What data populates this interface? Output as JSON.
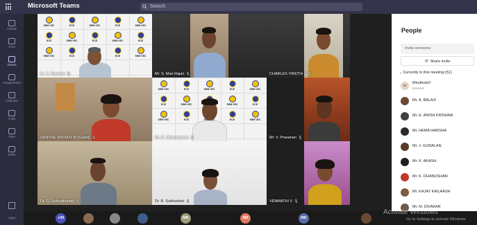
{
  "app": {
    "title": "Microsoft Teams"
  },
  "search": {
    "label": "Search"
  },
  "rail": {
    "items": [
      {
        "label": "Activity",
        "icon": "bell-icon"
      },
      {
        "label": "Chat",
        "icon": "chat-icon"
      },
      {
        "label": "Teams",
        "icon": "teams-icon"
      },
      {
        "label": "Assignments",
        "icon": "assignments-icon"
      },
      {
        "label": "Calendar",
        "icon": "calendar-icon"
      },
      {
        "label": "Calls",
        "icon": "phone-icon"
      },
      {
        "label": "Files",
        "icon": "file-icon"
      },
      {
        "label": "Shifts",
        "icon": "shifts-icon"
      }
    ],
    "apps_label": "Apps"
  },
  "logo_wall": {
    "college_short": "SRM VEC",
    "dept": "ECE"
  },
  "participants_video": [
    {
      "name": "Dr. S. Ramesh"
    },
    {
      "name": "Mr. S. Mari Rajan"
    },
    {
      "name": "CHARLES VINOTH J"
    },
    {
      "name": "SENTHIL PRIYA R M (Guest)"
    },
    {
      "name": "Mr. R. Dhananjeyan"
    },
    {
      "name": "Mr. V. Prasanan"
    },
    {
      "name": "Dr. G. Sathyakumar"
    },
    {
      "name": "Dr. B. Subhashini"
    },
    {
      "name": "VENMATHI V"
    }
  ],
  "strip": {
    "overflow_count": "+30",
    "avatars": [
      "MR",
      "SM",
      "MD"
    ]
  },
  "watermark": {
    "line1": "Activate Windows",
    "line2": "Go to Settings to activate Windows."
  },
  "people_panel": {
    "title": "People",
    "invite_placeholder": "Invite someone",
    "share_invite_label": "Share invite",
    "section_label": "Currently in this meeting (51)",
    "members": [
      {
        "name": "MiruthulaV",
        "sub": "External",
        "initials": "M",
        "color": "#e4d3c3"
      },
      {
        "name": "Mr. A. BALAJI",
        "sub": "",
        "initials": "",
        "color": "#6b4a35"
      },
      {
        "name": "Mr. E. ANISH KRISHNA",
        "sub": "",
        "initials": "",
        "color": "#3f3f3f"
      },
      {
        "name": "Mr. HEMA HARSHA",
        "sub": "",
        "initials": "",
        "color": "#2a2a2a"
      },
      {
        "name": "Mr. J. GUNALAN",
        "sub": "",
        "initials": "",
        "color": "#5b3a2a"
      },
      {
        "name": "Mr. K. AKASH",
        "sub": "",
        "initials": "",
        "color": "#1f1f1f"
      },
      {
        "name": "Mr. K. DHANUSHAN",
        "sub": "",
        "initials": "",
        "color": "#c0392b"
      },
      {
        "name": "Mr. KAJAY KAILAASH",
        "sub": "",
        "initials": "",
        "color": "#7a5c45"
      },
      {
        "name": "Mr. M. DIVAKAR",
        "sub": "",
        "initials": "",
        "color": "#6d5a4a"
      }
    ]
  }
}
